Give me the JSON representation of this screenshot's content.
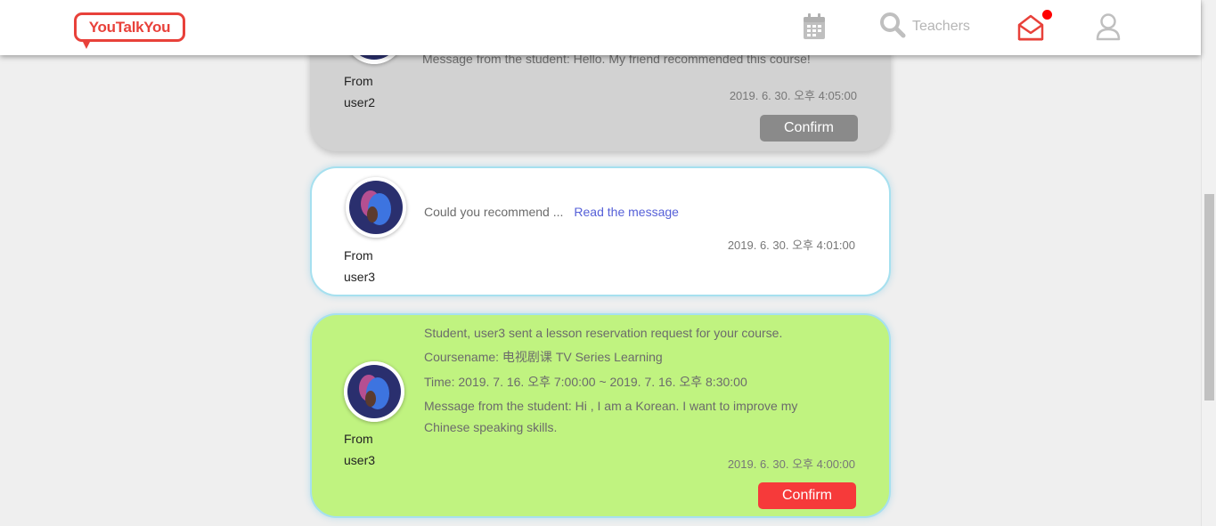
{
  "header": {
    "logo_text": "YouTalkYou",
    "teachers_label": "Teachers",
    "icons": [
      "calendar-icon",
      "search-icon",
      "mail-icon",
      "user-icon"
    ],
    "notification_color": "#ff0000",
    "brand_color": "#e8413a"
  },
  "messages": [
    {
      "state": "read",
      "from_label": "From",
      "from_user": "user2",
      "text": "Message from the student: Hello. My friend recommended this course!",
      "timestamp": "2019. 6. 30. 오후 4:05:00",
      "confirm_label": "Confirm"
    },
    {
      "state": "unread",
      "from_label": "From",
      "from_user": "user3",
      "text": "Could you recommend ...",
      "link": "Read the message",
      "timestamp": "2019. 6. 30. 오후 4:01:00"
    },
    {
      "state": "request",
      "from_label": "From",
      "from_user": "user3",
      "line1": "Student, user3 sent a lesson reservation request for your course.",
      "line2": "Coursename: 电视剧课 TV Series Learning",
      "line3": "Time: 2019. 7. 16. 오후 7:00:00 ~ 2019. 7. 16. 오후 8:30:00",
      "line4": "Message from the student: Hi , I am a Korean. I want to improve my",
      "line5": "Chinese speaking skills.",
      "timestamp": "2019. 6. 30. 오후 4:00:00",
      "confirm_label": "Confirm"
    }
  ]
}
